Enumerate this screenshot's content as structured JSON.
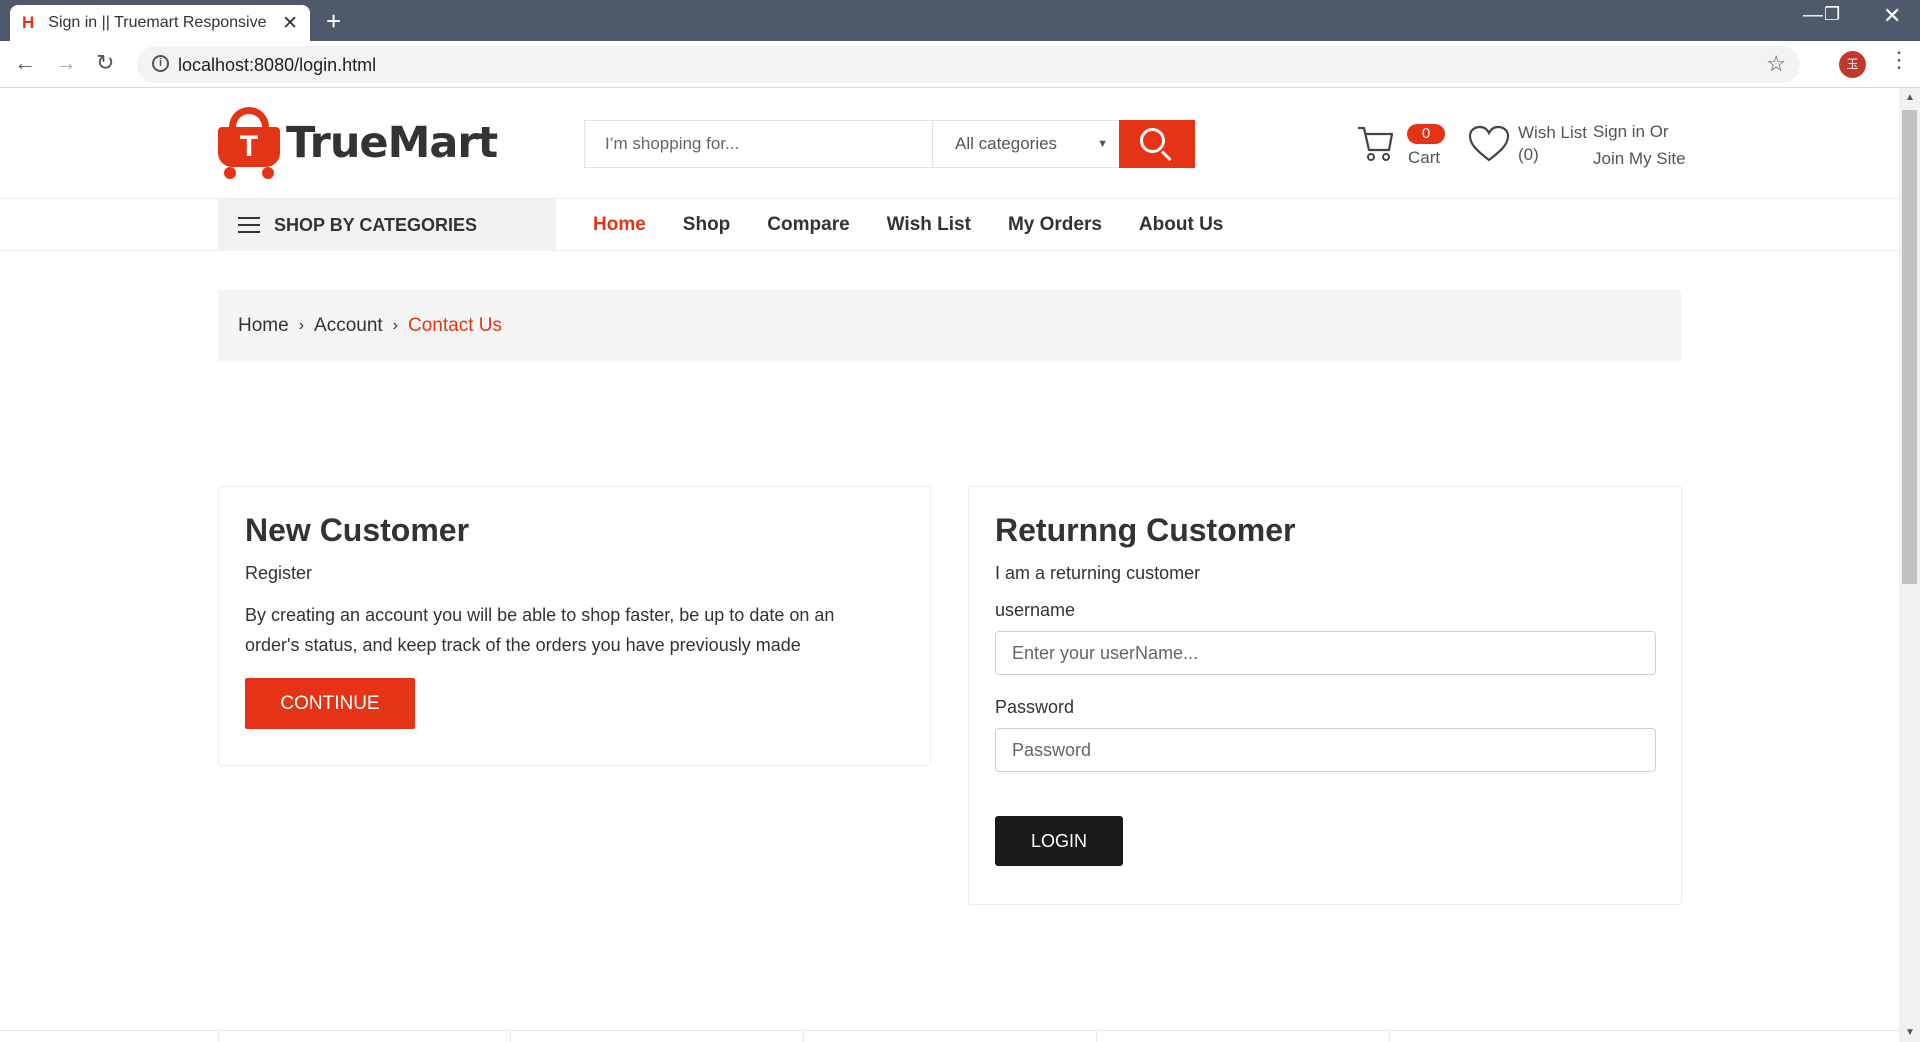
{
  "browser": {
    "tab_title": "Sign in || Truemart Responsive",
    "tab_favicon": "H",
    "url": "localhost:8080/login.html",
    "profile_initial": "玉"
  },
  "header": {
    "logo_text": "TrueMart",
    "logo_letter": "T",
    "search_placeholder": "I’m shopping for...",
    "category_select": "All categories",
    "cart_count": "0",
    "cart_label": "Cart",
    "wish_label": "Wish List (0)",
    "signin_line1": "Sign in Or",
    "signin_line2": "Join My Site"
  },
  "nav": {
    "shop_by_categories": "SHOP BY CATEGORIES",
    "items": [
      "Home",
      "Shop",
      "Compare",
      "Wish List",
      "My Orders",
      "About Us"
    ],
    "active": "Home"
  },
  "breadcrumb": {
    "items": [
      "Home",
      "Account"
    ],
    "current": "Contact Us"
  },
  "new_customer": {
    "title": "New Customer",
    "subtitle": "Register",
    "description": "By creating an account you will be able to shop faster, be up to date on an order's status, and keep track of the orders you have previously made",
    "button": "CONTINUE"
  },
  "returning_customer": {
    "title": "Returnng Customer",
    "subtitle": "I am a returning customer",
    "username_label": "username",
    "username_placeholder": "Enter your userName...",
    "password_label": "Password",
    "password_placeholder": "Password",
    "button": "LOGIN"
  },
  "colors": {
    "accent": "#e53316",
    "dark_button": "#1a1a1a",
    "chrome": "#4e5a6a"
  }
}
